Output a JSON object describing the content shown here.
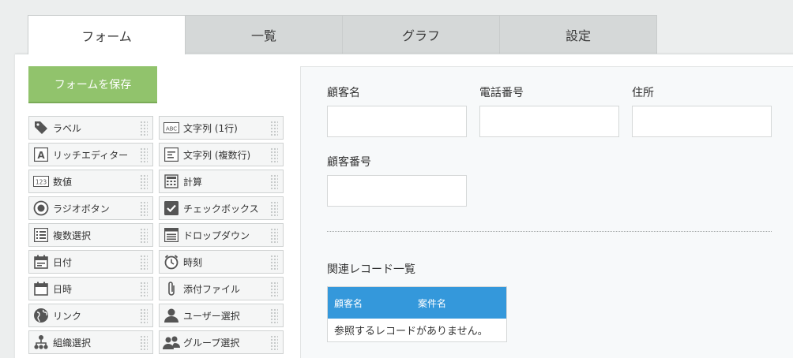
{
  "tabs": [
    {
      "label": "フォーム",
      "active": true
    },
    {
      "label": "一覧",
      "active": false
    },
    {
      "label": "グラフ",
      "active": false
    },
    {
      "label": "設定",
      "active": false
    }
  ],
  "save_button": "フォームを保存",
  "palette": [
    {
      "label": "ラベル",
      "icon": "tag-icon"
    },
    {
      "label": "文字列 (1行)",
      "icon": "abc-text-icon"
    },
    {
      "label": "リッチエディター",
      "icon": "rich-text-icon"
    },
    {
      "label": "文字列 (複数行)",
      "icon": "multiline-text-icon"
    },
    {
      "label": "数値",
      "icon": "number-icon"
    },
    {
      "label": "計算",
      "icon": "calculator-icon"
    },
    {
      "label": "ラジオボタン",
      "icon": "radio-icon"
    },
    {
      "label": "チェックボックス",
      "icon": "checkbox-icon"
    },
    {
      "label": "複数選択",
      "icon": "multi-select-icon"
    },
    {
      "label": "ドロップダウン",
      "icon": "dropdown-icon"
    },
    {
      "label": "日付",
      "icon": "calendar-icon"
    },
    {
      "label": "時刻",
      "icon": "clock-icon"
    },
    {
      "label": "日時",
      "icon": "datetime-icon"
    },
    {
      "label": "添付ファイル",
      "icon": "paperclip-icon"
    },
    {
      "label": "リンク",
      "icon": "globe-icon"
    },
    {
      "label": "ユーザー選択",
      "icon": "user-icon"
    },
    {
      "label": "組織選択",
      "icon": "org-icon"
    },
    {
      "label": "グループ選択",
      "icon": "group-icon"
    }
  ],
  "fields": {
    "customer_name": "顧客名",
    "phone": "電話番号",
    "address": "住所",
    "customer_number": "顧客番号"
  },
  "related": {
    "title": "関連レコード一覧",
    "columns": [
      "顧客名",
      "案件名"
    ],
    "empty": "参照するレコードがありません。"
  },
  "colors": {
    "save": "#91c36c",
    "table_header": "#3498db"
  }
}
